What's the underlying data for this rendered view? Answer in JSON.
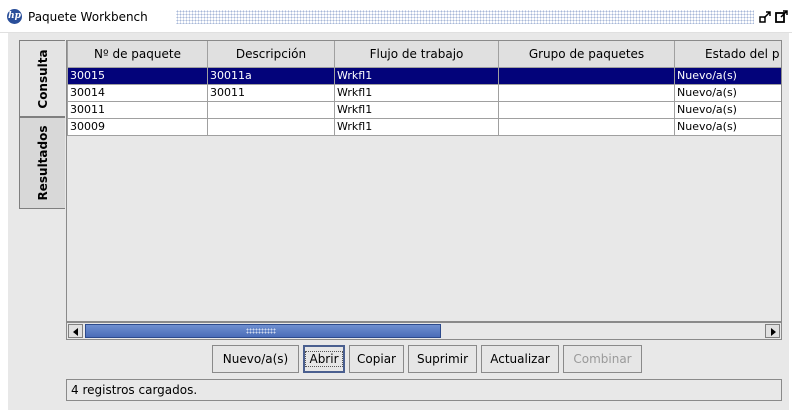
{
  "window": {
    "title": "Paquete Workbench",
    "logo_text": "hp"
  },
  "tabs": [
    {
      "label": "Consulta",
      "active": true
    },
    {
      "label": "Resultados",
      "active": false
    }
  ],
  "table": {
    "columns": [
      "Nº de paquete",
      "Descripción",
      "Flujo de trabajo",
      "Grupo de paquetes",
      "Estado del p"
    ],
    "rows": [
      {
        "cells": [
          "30015",
          "30011a",
          "Wrkfl1",
          "",
          "Nuevo/a(s)"
        ],
        "selected": true
      },
      {
        "cells": [
          "30014",
          "30011",
          "Wrkfl1",
          "",
          "Nuevo/a(s)"
        ],
        "selected": false
      },
      {
        "cells": [
          "30011",
          "",
          "Wrkfl1",
          "",
          "Nuevo/a(s)"
        ],
        "selected": false
      },
      {
        "cells": [
          "30009",
          "",
          "Wrkfl1",
          "",
          "Nuevo/a(s)"
        ],
        "selected": false
      }
    ]
  },
  "buttons": {
    "nuevo": "Nuevo/a(s)",
    "abrir": "Abrir",
    "copiar": "Copiar",
    "suprimir": "Suprimir",
    "actualizar": "Actualizar",
    "combinar": "Combinar"
  },
  "status": "4 registros cargados.",
  "colors": {
    "selection": "#03037a",
    "logo": "#2a4f9a",
    "scroll_thumb": "#4a6db8"
  },
  "icons": [
    "hp-logo-icon",
    "minimize-icon",
    "maximize-icon",
    "scroll-left-icon",
    "scroll-right-icon"
  ]
}
